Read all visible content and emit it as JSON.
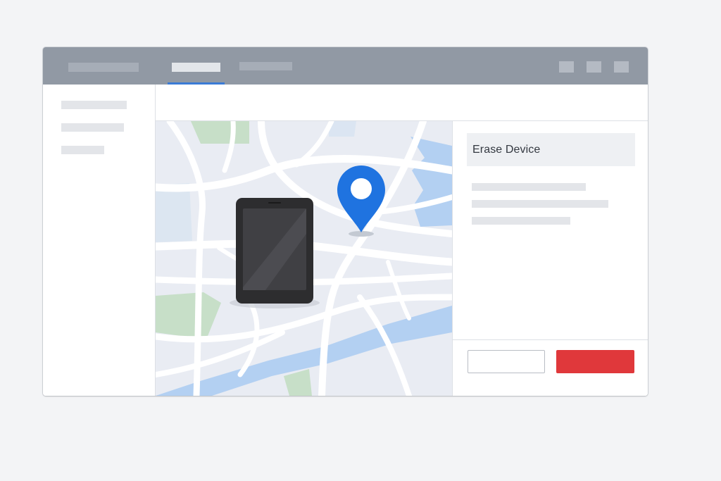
{
  "colors": {
    "titlebar": "#9199a4",
    "active_tab_indicator": "#3b7bd6",
    "map_background": "#e9ecf3",
    "map_park": "#c7dfc8",
    "map_water": "#b3d0f2",
    "pin": "#1f73e0",
    "erase_button": "#e0383b"
  },
  "titlebar": {
    "title_placeholder": true,
    "tabs": [
      {
        "id": "tab-1",
        "active": true
      },
      {
        "id": "tab-2",
        "active": false
      }
    ],
    "window_controls": [
      "window-control",
      "window-control",
      "window-control"
    ]
  },
  "sidebar": {
    "items": [
      {
        "id": "item-1"
      },
      {
        "id": "item-2"
      },
      {
        "id": "item-3"
      }
    ]
  },
  "map": {
    "device_icon": "tablet-icon",
    "pin_icon": "location-pin-icon"
  },
  "panel": {
    "title": "Erase Device",
    "text_lines": 3,
    "buttons": {
      "cancel_icon": "",
      "erase_icon": ""
    }
  }
}
